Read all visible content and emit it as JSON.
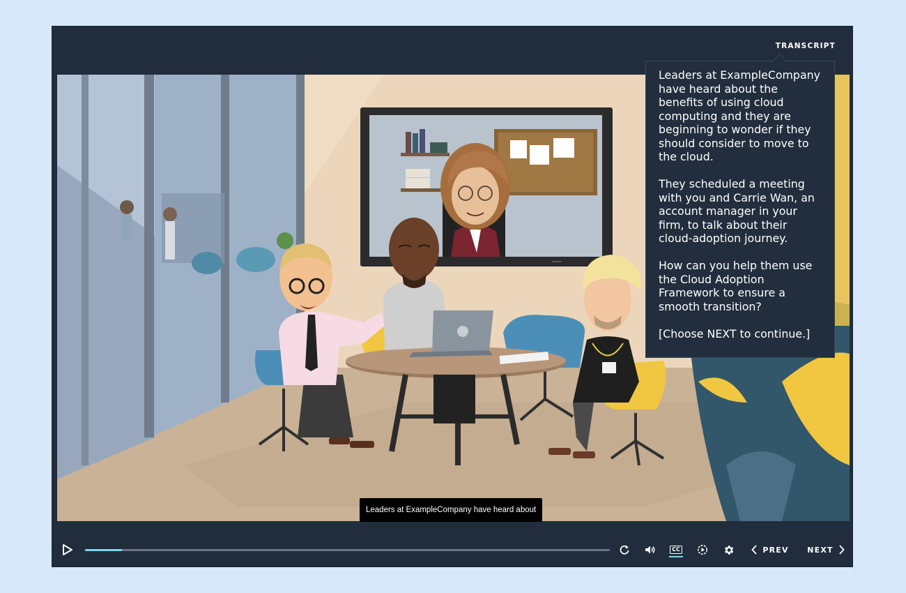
{
  "header": {
    "transcript_label": "TRANSCRIPT"
  },
  "caption": {
    "text": "Leaders at ExampleCompany have heard about"
  },
  "transcript": {
    "paragraphs": [
      "Leaders at ExampleCompany have heard about the benefits of using cloud computing and they are beginning to wonder if they should consider to move to the cloud.",
      "They scheduled a meeting with you and Carrie Wan, an account manager in your firm, to talk about their cloud-adoption journey.",
      "How can you help them use the Cloud Adoption Framework to ensure a smooth transition?",
      "[Choose NEXT to continue.]"
    ]
  },
  "controls": {
    "progress_fraction": 0.07,
    "prev_label": "PREV",
    "next_label": "NEXT",
    "cc_label": "CC",
    "icons": [
      "play-icon",
      "replay-icon",
      "volume-icon",
      "closed-captions-icon",
      "playback-speed-icon",
      "settings-gear-icon",
      "chevron-left-icon",
      "chevron-right-icon"
    ]
  },
  "colors": {
    "page_bg": "#d7e8fb",
    "player_bg": "#212d3c",
    "progress_fill": "#7fd6ec",
    "progress_track": "#6c7683"
  }
}
